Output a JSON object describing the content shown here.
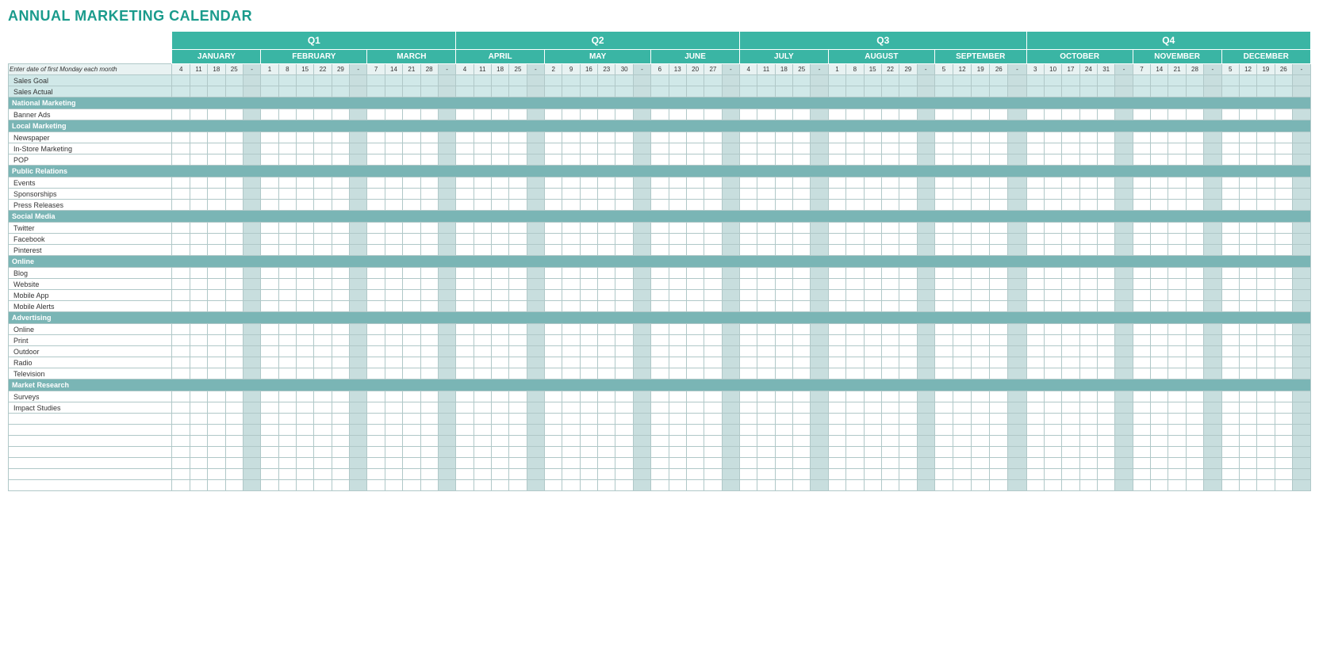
{
  "title": "ANNUAL MARKETING CALENDAR",
  "quarters": [
    {
      "label": "Q1",
      "span": 14,
      "class": "q1-header"
    },
    {
      "label": "Q2",
      "span": 12,
      "class": "q2-header"
    },
    {
      "label": "Q3",
      "span": 14,
      "class": "q3-header"
    },
    {
      "label": "Q4",
      "span": 14,
      "class": "q4-header"
    }
  ],
  "months": [
    {
      "label": "JANUARY",
      "weeks": [
        "4",
        "11",
        "18",
        "25",
        "-"
      ],
      "span": 5
    },
    {
      "label": "FEBRUARY",
      "weeks": [
        "1",
        "8",
        "15",
        "22",
        "29",
        "-"
      ],
      "span": 6
    },
    {
      "label": "MARCH",
      "weeks": [
        "7",
        "14",
        "21",
        "28",
        "-"
      ],
      "span": 5
    },
    {
      "label": "APRIL",
      "weeks": [
        "4",
        "11",
        "18",
        "25",
        "-"
      ],
      "span": 5
    },
    {
      "label": "MAY",
      "weeks": [
        "2",
        "9",
        "16",
        "23",
        "30",
        "-"
      ],
      "span": 5
    },
    {
      "label": "JUNE",
      "weeks": [
        "6",
        "13",
        "20",
        "27",
        "-"
      ],
      "span": 5
    },
    {
      "label": "JULY",
      "weeks": [
        "4",
        "11",
        "18",
        "25",
        "-"
      ],
      "span": 5
    },
    {
      "label": "AUGUST",
      "weeks": [
        "1",
        "8",
        "15",
        "22",
        "29",
        "-"
      ],
      "span": 6
    },
    {
      "label": "SEPTEMBER",
      "weeks": [
        "5",
        "12",
        "19",
        "26",
        "-"
      ],
      "span": 5
    },
    {
      "label": "OCTOBER",
      "weeks": [
        "3",
        "10",
        "17",
        "24",
        "31",
        "-"
      ],
      "span": 6
    },
    {
      "label": "NOVEMBER",
      "weeks": [
        "7",
        "14",
        "21",
        "28",
        "-"
      ],
      "span": 5
    },
    {
      "label": "DECEMBER",
      "weeks": [
        "5",
        "12",
        "19",
        "26",
        "-"
      ],
      "span": 5
    }
  ],
  "date_row_label": "Enter date of first Monday each month",
  "categories": [
    {
      "type": "section",
      "label": ""
    },
    {
      "type": "data",
      "label": "Sales Goal",
      "rowClass": "sales-goal-row"
    },
    {
      "type": "data",
      "label": "Sales Actual",
      "rowClass": "sales-actual-row"
    },
    {
      "type": "cat",
      "label": "National Marketing"
    },
    {
      "type": "data",
      "label": "Banner Ads",
      "rowClass": "data-row"
    },
    {
      "type": "cat",
      "label": "Local Marketing"
    },
    {
      "type": "data",
      "label": "Newspaper",
      "rowClass": "data-row"
    },
    {
      "type": "data",
      "label": "In-Store Marketing",
      "rowClass": "data-row"
    },
    {
      "type": "data",
      "label": "POP",
      "rowClass": "data-row"
    },
    {
      "type": "cat",
      "label": "Public Relations"
    },
    {
      "type": "data",
      "label": "Events",
      "rowClass": "data-row"
    },
    {
      "type": "data",
      "label": "Sponsorships",
      "rowClass": "data-row"
    },
    {
      "type": "data",
      "label": "Press Releases",
      "rowClass": "data-row"
    },
    {
      "type": "cat",
      "label": "Social Media"
    },
    {
      "type": "data",
      "label": "Twitter",
      "rowClass": "data-row"
    },
    {
      "type": "data",
      "label": "Facebook",
      "rowClass": "data-row"
    },
    {
      "type": "data",
      "label": "Pinterest",
      "rowClass": "data-row"
    },
    {
      "type": "cat",
      "label": "Online"
    },
    {
      "type": "data",
      "label": "Blog",
      "rowClass": "data-row"
    },
    {
      "type": "data",
      "label": "Website",
      "rowClass": "data-row"
    },
    {
      "type": "data",
      "label": "Mobile App",
      "rowClass": "data-row"
    },
    {
      "type": "data",
      "label": "Mobile Alerts",
      "rowClass": "data-row"
    },
    {
      "type": "cat",
      "label": "Advertising"
    },
    {
      "type": "data",
      "label": "Online",
      "rowClass": "data-row"
    },
    {
      "type": "data",
      "label": "Print",
      "rowClass": "data-row"
    },
    {
      "type": "data",
      "label": "Outdoor",
      "rowClass": "data-row"
    },
    {
      "type": "data",
      "label": "Radio",
      "rowClass": "data-row"
    },
    {
      "type": "data",
      "label": "Television",
      "rowClass": "data-row"
    },
    {
      "type": "cat",
      "label": "Market Research"
    },
    {
      "type": "data",
      "label": "Surveys",
      "rowClass": "data-row"
    },
    {
      "type": "data",
      "label": "Impact Studies",
      "rowClass": "data-row"
    },
    {
      "type": "empty",
      "label": ""
    },
    {
      "type": "empty",
      "label": ""
    },
    {
      "type": "empty",
      "label": ""
    },
    {
      "type": "empty",
      "label": ""
    },
    {
      "type": "empty",
      "label": ""
    },
    {
      "type": "empty",
      "label": ""
    },
    {
      "type": "empty",
      "label": ""
    }
  ]
}
